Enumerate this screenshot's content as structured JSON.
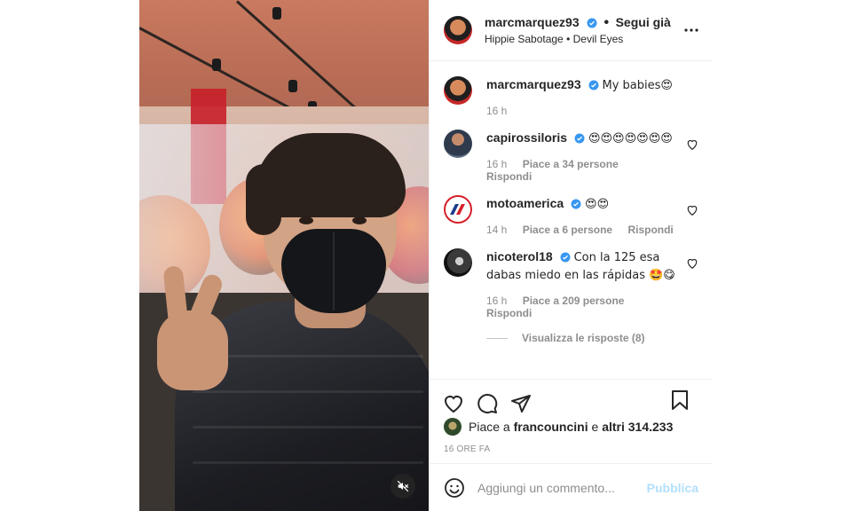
{
  "post": {
    "author": "marcmarquez93",
    "follow_label": "Segui già",
    "dot": "•",
    "audio": "Hippie Sabotage • Devil Eyes",
    "caption": {
      "author": "marcmarquez93",
      "text": "My babies😍",
      "time": "16 h"
    }
  },
  "comments": [
    {
      "user": "capirossiloris",
      "verified": true,
      "text": "😍😍😍😍😍😍😍",
      "time": "16 h",
      "likes": "Piace a 34 persone",
      "reply": "Rispondi"
    },
    {
      "user": "motoamerica",
      "verified": true,
      "text": "😍😍",
      "time": "14 h",
      "likes": "Piace a 6 persone",
      "reply": "Rispondi"
    },
    {
      "user": "nicoterol18",
      "verified": true,
      "text": "Con la 125 esa dabas miedo en las rápidas 🤩😋",
      "time": "16 h",
      "likes": "Piace a 209 persone",
      "reply": "Rispondi"
    }
  ],
  "view_replies": "Visualizza le risposte (8)",
  "likes": {
    "prefix": "Piace a",
    "user": "francouncini",
    "middle": "e",
    "others": "altri 314.233"
  },
  "posted_ago": "16 ORE FA",
  "comment_box": {
    "placeholder": "Aggiungi un commento...",
    "publish_label": "Pubblica"
  },
  "icons": {
    "more": "more-horizontal-icon",
    "verified": "verified-badge-icon",
    "heart": "heart-icon",
    "comment": "comment-icon",
    "share": "paper-plane-icon",
    "save": "bookmark-icon",
    "emoji": "smiley-icon",
    "mute": "muted-speaker-icon"
  },
  "colors": {
    "verified": "#3897f0",
    "publish": "#b2dffc",
    "meta": "#8e8e8e"
  }
}
